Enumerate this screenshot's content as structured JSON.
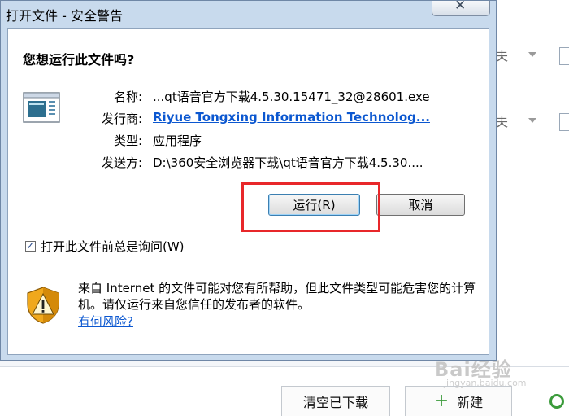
{
  "dialog": {
    "title": "打开文件 - 安全警告",
    "question": "您想运行此文件吗?",
    "fields": [
      {
        "label": "名称:",
        "value": "...qt语音官方下载4.5.30.15471_32@28601.exe"
      },
      {
        "label": "发行商:",
        "value": "Riyue Tongxing Information Technolog..."
      },
      {
        "label": "类型:",
        "value": "应用程序"
      },
      {
        "label": "发送方:",
        "value": "D:\\360安全浏览器下载\\qt语音官方下载4.5.30...."
      }
    ],
    "run_label": "运行(R)",
    "cancel_label": "取消",
    "checkbox_label": "打开此文件前总是询问(W)",
    "checkbox_checked": true,
    "warning_text": "来自 Internet 的文件可能对您有所帮助，但此文件类型可能危害您的计算机。请仅运行来自您信任的发布者的软件。",
    "risk_link": "有何风险?",
    "highlight_color": "#e8272a",
    "link_color": "#0b57d0"
  },
  "background": {
    "row_partial_text": [
      "夫",
      "夫"
    ],
    "clear_button": "清空已下载",
    "new_button": "新建",
    "watermark": "Bai经验",
    "watermark_sub": "jingyan.baidu.com"
  },
  "icons": {
    "close": "close-icon",
    "file": "application-file-icon",
    "warning": "shield-warning-icon",
    "plus": "plus-icon",
    "gear": "gear-icon"
  }
}
